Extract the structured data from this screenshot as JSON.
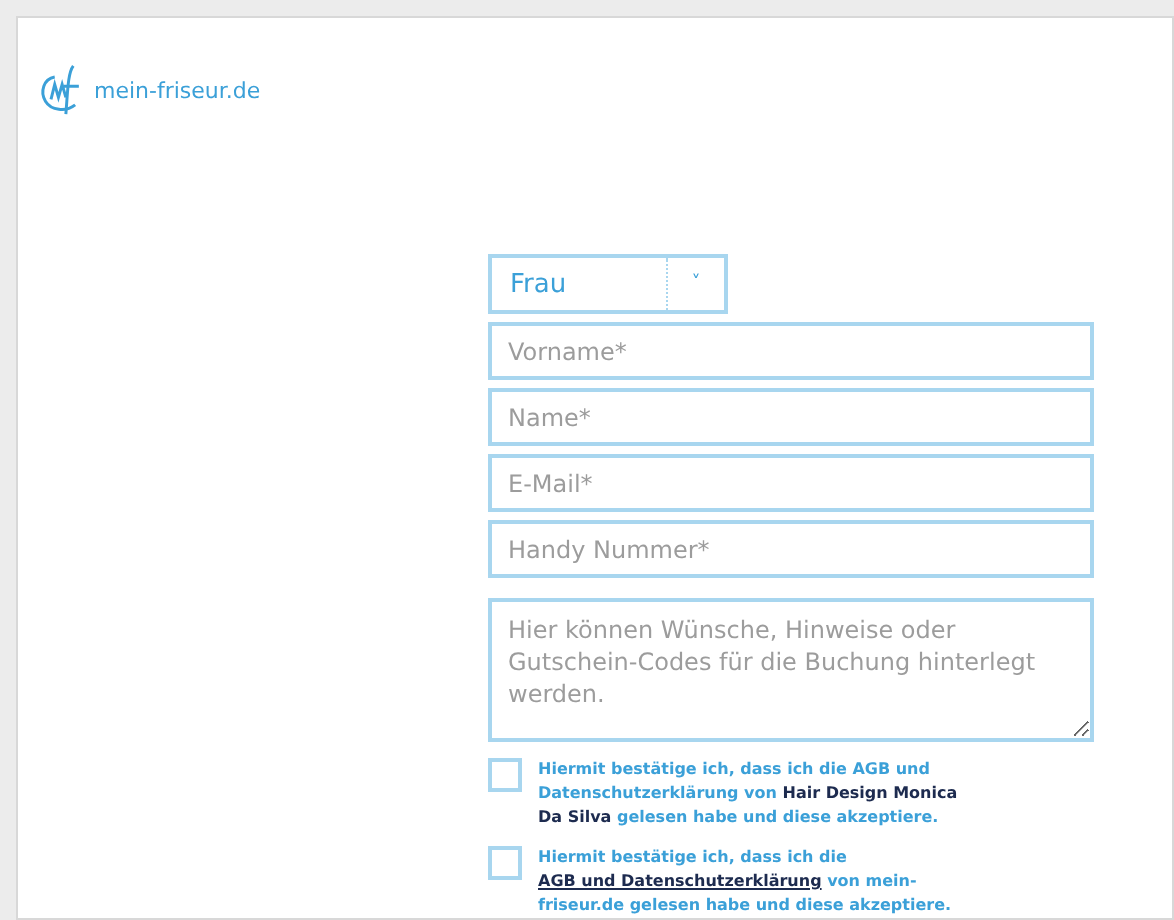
{
  "logo": {
    "text": "mein-friseur.de"
  },
  "salutation": {
    "value": "Frau",
    "caret": "˅"
  },
  "fields": [
    {
      "placeholder": "Vorname*"
    },
    {
      "placeholder": "Name*"
    },
    {
      "placeholder": "E-Mail*"
    },
    {
      "placeholder": "Handy Nummer*"
    }
  ],
  "notes": {
    "placeholder": "Hier können Wünsche, Hinweise oder Gutschein-Codes für die Buchung hinterlegt werden."
  },
  "consents": [
    {
      "checked": false,
      "parts": [
        {
          "kind": "plain",
          "text": "Hiermit bestätige ich, dass ich die AGB und Datenschutzerklärung von"
        },
        {
          "kind": "strong",
          "text": "Hair Design Monica Da Silva"
        },
        {
          "kind": "plain",
          "text": "gelesen habe und diese akzeptiere."
        }
      ]
    },
    {
      "checked": false,
      "parts": [
        {
          "kind": "plain",
          "text": "Hiermit bestätige ich, dass ich die"
        },
        {
          "kind": "link",
          "text": "AGB und Datenschutzerklärung"
        },
        {
          "kind": "plain",
          "text": "von mein-friseur.de gelesen habe und diese akzeptiere."
        }
      ]
    }
  ]
}
